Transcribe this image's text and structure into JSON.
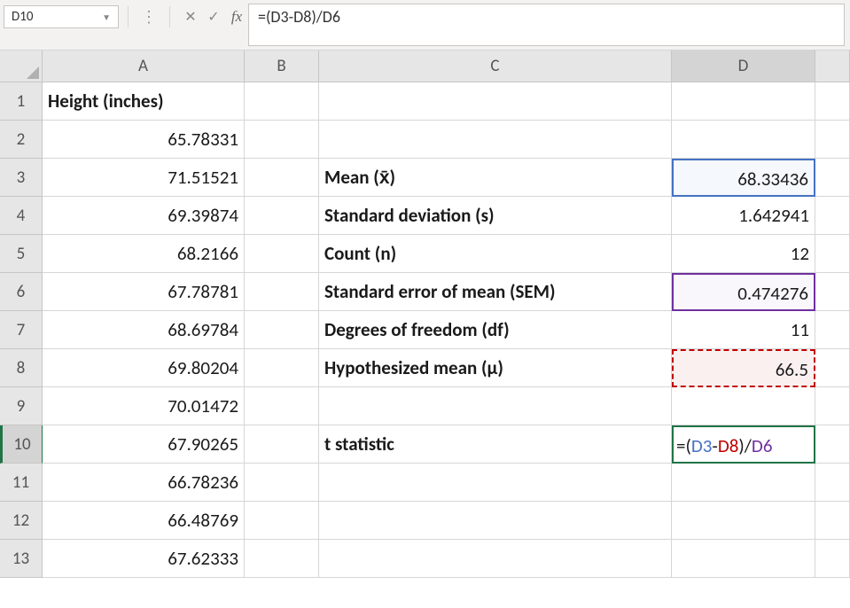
{
  "nameBox": "D10",
  "formulaBar": "=(D3-D8)/D6",
  "columns": [
    "A",
    "B",
    "C",
    "D",
    ""
  ],
  "rowNumbers": [
    "1",
    "2",
    "3",
    "4",
    "5",
    "6",
    "7",
    "8",
    "9",
    "10",
    "11",
    "12",
    "13"
  ],
  "cells": {
    "A1": "Height (inches)",
    "A2": "65.78331",
    "A3": "71.51521",
    "A4": "69.39874",
    "A5": "68.2166",
    "A6": "67.78781",
    "A7": "68.69784",
    "A8": "69.80204",
    "A9": "70.01472",
    "A10": "67.90265",
    "A11": "66.78236",
    "A12": "66.48769",
    "A13": "67.62333",
    "C3": "Mean (x̄)",
    "C4": "Standard deviation (s)",
    "C5": "Count (n)",
    "C6": "Standard error of mean (SEM)",
    "C7": "Degrees of freedom (df)",
    "C8": "Hypothesized mean (µ)",
    "C10": "t statistic",
    "D3": "68.33436",
    "D4": "1.642941",
    "D5": "12",
    "D6": "0.474276",
    "D7": "11",
    "D8": "66.5"
  },
  "editFormula": {
    "prefix": "=(",
    "ref1": "D3",
    "mid1": "-",
    "ref2": "D8",
    "mid2": ")/",
    "ref3": "D6"
  }
}
